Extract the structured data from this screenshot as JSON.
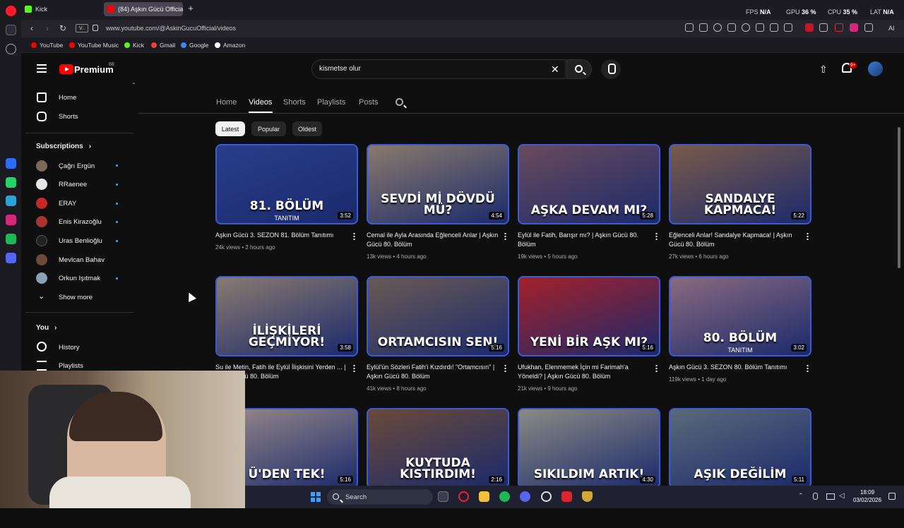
{
  "browser": {
    "tabs": [
      {
        "label": "Kick",
        "color": "#53fc18"
      },
      {
        "label": "(84) Aşkın Gücü Official -",
        "color": "#ff0000"
      }
    ],
    "stats": {
      "fps_label": "FPS",
      "fps_value": "N/A",
      "gpu_label": "GPU",
      "gpu_value": "36 %",
      "cpu_label": "CPU",
      "cpu_value": "35 %",
      "lat_label": "LAT",
      "lat_value": "N/A"
    },
    "url": "www.youtube.com/@AskinGucuOfficial/videos",
    "url_badge": "V..",
    "ai_label": "AI",
    "bookmarks": [
      {
        "label": "YouTube",
        "color": "#ff0000"
      },
      {
        "label": "YouTube Music",
        "color": "#ff0000"
      },
      {
        "label": "Kick",
        "color": "#53fc18"
      },
      {
        "label": "Gmail",
        "color": "#ea4335"
      },
      {
        "label": "Google",
        "color": "#4285f4"
      },
      {
        "label": "Amazon",
        "color": "#ffffff"
      }
    ]
  },
  "header": {
    "premium_label": "Premium",
    "premium_sup": "68",
    "search_value": "kismetse olur",
    "notif_count": "9+"
  },
  "sidebar": {
    "home": "Home",
    "shorts": "Shorts",
    "subscriptions": "Subscriptions",
    "subs": [
      {
        "name": "Çağrı Ergün",
        "color": "#7a6a5a"
      },
      {
        "name": "RRaenee",
        "color": "#e6e6e6"
      },
      {
        "name": "ERAY",
        "color": "#c62828"
      },
      {
        "name": "Enis Kirazoğlu",
        "color": "#a33"
      },
      {
        "name": "Uras Benlioğlu",
        "color": "#222"
      },
      {
        "name": "Mevlcan Bahav",
        "color": "#6b4c3b"
      },
      {
        "name": "Orkun Işıtmak",
        "color": "#8aa0b5"
      }
    ],
    "show_more": "Show more",
    "you": "You",
    "history": "History",
    "playlists": "Playlists"
  },
  "channel_tabs": [
    "Home",
    "Videos",
    "Shorts",
    "Playlists",
    "Posts"
  ],
  "chips": [
    "Latest",
    "Popular",
    "Oldest"
  ],
  "videos": [
    {
      "caption": "81. BÖLÜM",
      "caption2": "TANITIM",
      "duration": "3:52",
      "title": "Aşkın Gücü 3. SEZON 81. Bölüm Tanıtımı",
      "views": "24k views",
      "age": "2 hours ago",
      "bg": "#2a3c8c"
    },
    {
      "caption": "SEVDİ Mİ DÖVDÜ MÜ?",
      "caption2": "",
      "duration": "4:54",
      "title": "Cemal ile Ayla Arasında Eğlenceli Anlar | Aşkın Gücü 80. Bölüm",
      "views": "13k views",
      "age": "4 hours ago",
      "bg": "#8a7a6c"
    },
    {
      "caption": "AŞKA DEVAM MI?",
      "caption2": "",
      "duration": "5:28",
      "title": "Eylül ile Fatih, Barışır mı? | Aşkın Gücü 80. Bölüm",
      "views": "19k views",
      "age": "5 hours ago",
      "bg": "#6a4a5c"
    },
    {
      "caption": "SANDALYE KAPMACA!",
      "caption2": "",
      "duration": "5:22",
      "title": "Eğlenceli Anlar! Sandalye Kapmaca! | Aşkın Gücü 80. Bölüm",
      "views": "27k views",
      "age": "6 hours ago",
      "bg": "#7a5a4a"
    },
    {
      "caption": "İLİŞKİLERİ GEÇMİYOR!",
      "caption2": "",
      "duration": "3:58",
      "title": "Su ile Metin, Fatih ile Eylül İlişkisini Yerden ... | Aşkın Gücü 80. Bölüm",
      "views": "",
      "age": "7 hours ago",
      "bg": "#8a7a70"
    },
    {
      "caption": "ORTAMCISIN SEN!",
      "caption2": "",
      "duration": "5:16",
      "title": "Eylül'ün Sözleri Fatih'i Kızdırdı! \"Ortamcısın\" | Aşkın Gücü 80. Bölüm",
      "views": "41k views",
      "age": "8 hours ago",
      "bg": "#6a5a54"
    },
    {
      "caption": "YENİ BİR AŞK MI?",
      "caption2": "",
      "duration": "5:16",
      "title": "Ufukhan, Elenmemek İçin mi Farimah'a Yöneldi? | Aşkın Gücü 80. Bölüm",
      "views": "21k views",
      "age": "9 hours ago",
      "bg": "#a5202a"
    },
    {
      "caption": "80. BÖLÜM",
      "caption2": "TANITIM",
      "duration": "3:02",
      "title": "Aşkın Gücü 3. SEZON 80. Bölüm Tanıtımı",
      "views": "119k views",
      "age": "1 day ago",
      "bg": "#8a6a80"
    },
    {
      "caption": "Ü'DEN TEK!",
      "caption2": "",
      "duration": "5:16",
      "title": "",
      "views": "",
      "age": "",
      "bg": "#9a8a8a"
    },
    {
      "caption": "KUYTUDA KISTIRDIM!",
      "caption2": "",
      "duration": "2:16",
      "title": "",
      "views": "",
      "age": "",
      "bg": "#6a4a3a"
    },
    {
      "caption": "SIKILDIM ARTIK!",
      "caption2": "",
      "duration": "4:30",
      "title": "",
      "views": "",
      "age": "",
      "bg": "#8a8a84"
    },
    {
      "caption": "AŞIK DEĞİLİM",
      "caption2": "",
      "duration": "5:11",
      "title": "",
      "views": "",
      "age": "",
      "bg": "#5a6a7a"
    }
  ],
  "taskbar": {
    "search_label": "Search",
    "time": "18:09",
    "date": "03/02/2026"
  }
}
